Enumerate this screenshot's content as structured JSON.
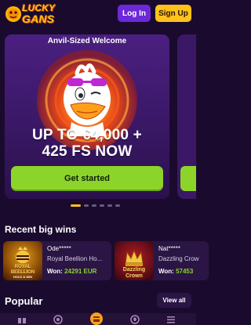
{
  "header": {
    "logo_line1": "LUCKY",
    "logo_line2": "GANS",
    "login_label": "Log In",
    "signup_label": "Sign Up"
  },
  "promo": {
    "eyebrow": "Anvil-Sized Welcome",
    "headline_line1": "UP TO €4,000 +",
    "headline_line2": "425 FS NOW",
    "cta_label": "Get started",
    "slides_total": 6,
    "active_slide": 1
  },
  "recent_wins": {
    "title": "Recent big wins",
    "items": [
      {
        "user": "Ode*****",
        "game": "Royal Beellion Ho...",
        "thumb_line1": "ROYAL",
        "thumb_line2": "BEELLION",
        "thumb_line3": "HOLD & WIN",
        "amount_label": "Won:",
        "amount": "24291 EUR"
      },
      {
        "user": "Nat*****",
        "game": "Dazzling Crow",
        "thumb_line1": "Dazzling",
        "thumb_line2": "Crown",
        "amount_label": "Won:",
        "amount": "57453"
      }
    ]
  },
  "popular": {
    "title": "Popular",
    "view_all_label": "View all"
  },
  "bottom_nav": {
    "items": [
      "gift-icon",
      "chip-icon",
      "casino-chest-icon",
      "soccer-ball-icon",
      "menu-icon"
    ]
  },
  "colors": {
    "background": "#1a0b2e",
    "accent_yellow": "#ffc21a",
    "accent_purple": "#6d28d9",
    "cta_green": "#8dd42a"
  }
}
